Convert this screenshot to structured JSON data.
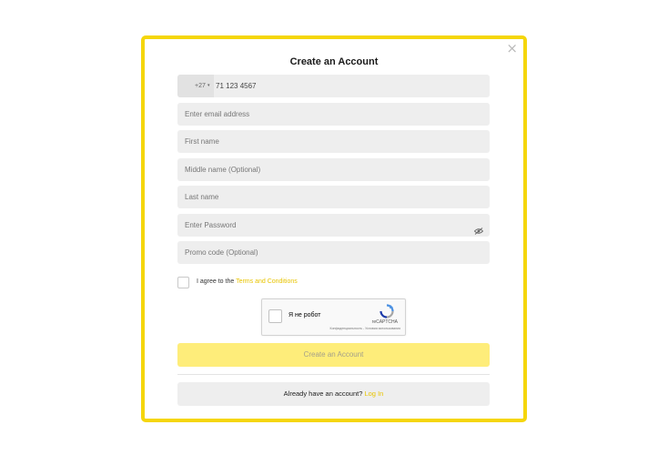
{
  "modal": {
    "title": "Create an Account",
    "close_icon": "×"
  },
  "phone": {
    "country_flag": "south-africa-flag-icon",
    "country_code": "+27",
    "caret": "▾",
    "value": "71 123 4567"
  },
  "fields": {
    "email_placeholder": "Enter email address",
    "first_name_placeholder": "First name",
    "middle_name_placeholder": "Middle name (Optional)",
    "last_name_placeholder": "Last name",
    "password_placeholder": "Enter Password",
    "promo_placeholder": "Promo code (Optional)"
  },
  "agree": {
    "text": "I agree to the ",
    "link": "Terms and Conditions"
  },
  "captcha": {
    "label": "Я не робот",
    "brand": "reCAPTCHA",
    "links": "Конфиденциальность - Условия использования"
  },
  "buttons": {
    "create_label": "Create an Account"
  },
  "login": {
    "text": "Already have an account? ",
    "link": "Log In"
  },
  "colors": {
    "accent": "#f5d60a",
    "button_bg": "#feed7a",
    "field_bg": "#eeeeee"
  }
}
